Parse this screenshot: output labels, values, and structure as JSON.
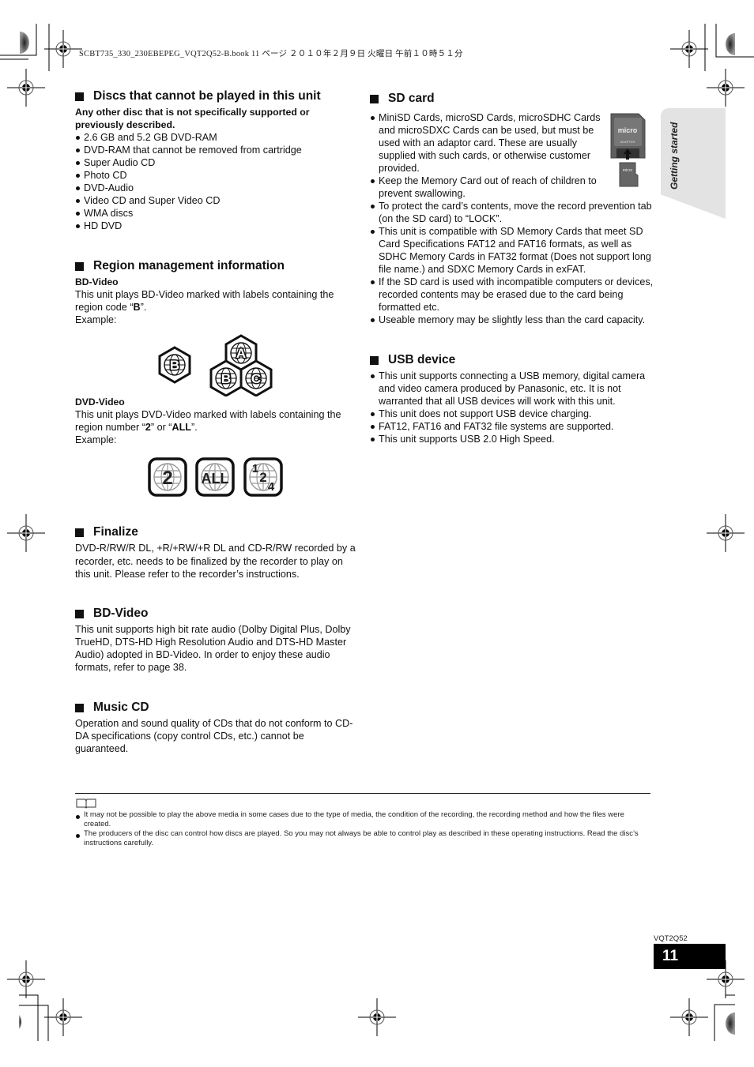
{
  "print_header": "SCBT735_330_230EBEPEG_VQT2Q52-B.book  11 ページ  ２０１０年２月９日  火曜日  午前１０時５１分",
  "side_tab": {
    "label": "Getting started"
  },
  "left": {
    "discs": {
      "title": "Discs that cannot be played in this unit",
      "intro": "Any other disc that is not specifically supported or previously described.",
      "items": [
        "2.6 GB and 5.2 GB DVD-RAM",
        "DVD-RAM that cannot be removed from cartridge",
        "Super Audio CD",
        "Photo CD",
        "DVD-Audio",
        "Video CD and Super Video CD",
        "WMA discs",
        "HD DVD"
      ]
    },
    "region": {
      "title": "Region management information",
      "bd": {
        "subtitle": "BD-Video",
        "text_before": "This unit plays BD-Video marked with labels containing the region code “",
        "code": "B",
        "text_after": "”.",
        "example": "Example:",
        "labels": [
          "B",
          "A",
          "B",
          "C"
        ]
      },
      "dvd": {
        "subtitle": "DVD-Video",
        "text_before": "This unit plays DVD-Video marked with labels containing the region number “",
        "code1": "2",
        "text_mid": "” or “",
        "code2": "ALL",
        "text_after": "”.",
        "example": "Example:",
        "labels": [
          "2",
          "ALL",
          "1",
          "2",
          "4"
        ]
      }
    },
    "finalize": {
      "title": "Finalize",
      "text": "DVD-R/RW/R DL, +R/+RW/+R DL and CD-R/RW recorded by a recorder, etc. needs to be finalized by the recorder to play on this unit. Please refer to the recorder’s instructions."
    },
    "bdvideo": {
      "title": "BD-Video",
      "text": "This unit supports high bit rate audio (Dolby Digital Plus, Dolby TrueHD, DTS-HD High Resolution Audio and DTS-HD Master Audio) adopted in BD-Video. In order to enjoy these audio formats, refer to page 38."
    },
    "musiccd": {
      "title": "Music CD",
      "text": "Operation and sound quality of CDs that do not conform to CD-DA specifications (copy control CDs, etc.) cannot be guaranteed."
    }
  },
  "right": {
    "sd": {
      "title": "SD card",
      "items": [
        "MiniSD Cards, microSD Cards, microSDHC Cards and microSDXC Cards can be used, but must be used with an adaptor card. These are usually supplied with such cards, or otherwise customer provided.",
        "Keep the Memory Card out of reach of children to prevent swallowing.",
        "To protect the card’s contents, move the record prevention tab (on the SD card) to “LOCK”.",
        "This unit is compatible with SD Memory Cards that meet SD Card Specifications FAT12 and FAT16 formats, as well as SDHC Memory Cards in FAT32 format (Does not support long file name.) and SDXC Memory Cards in exFAT.",
        "If the SD card is used with incompatible computers or devices, recorded contents may be erased due to the card being formatted etc.",
        "Useable memory may be slightly less than the card capacity."
      ],
      "adapter_label": "ADAPTER",
      "micro_label": "micro SD"
    },
    "usb": {
      "title": "USB device",
      "items": [
        "This unit supports connecting a USB memory, digital camera and video camera produced by Panasonic, etc. It is not warranted that all USB devices will work with this unit.",
        "This unit does not support USB device charging.",
        "FAT12, FAT16 and FAT32 file systems are supported.",
        "This unit supports USB 2.0 High Speed."
      ]
    }
  },
  "notes": [
    "It may not be possible to play the above media in some cases due to the type of media, the condition of the recording, the recording method and how the files were created.",
    "The producers of the disc can control how discs are played. So you may not always be able to control play as described in these operating instructions. Read the disc’s instructions carefully."
  ],
  "footer": {
    "code": "VQT2Q52",
    "page": "11"
  }
}
